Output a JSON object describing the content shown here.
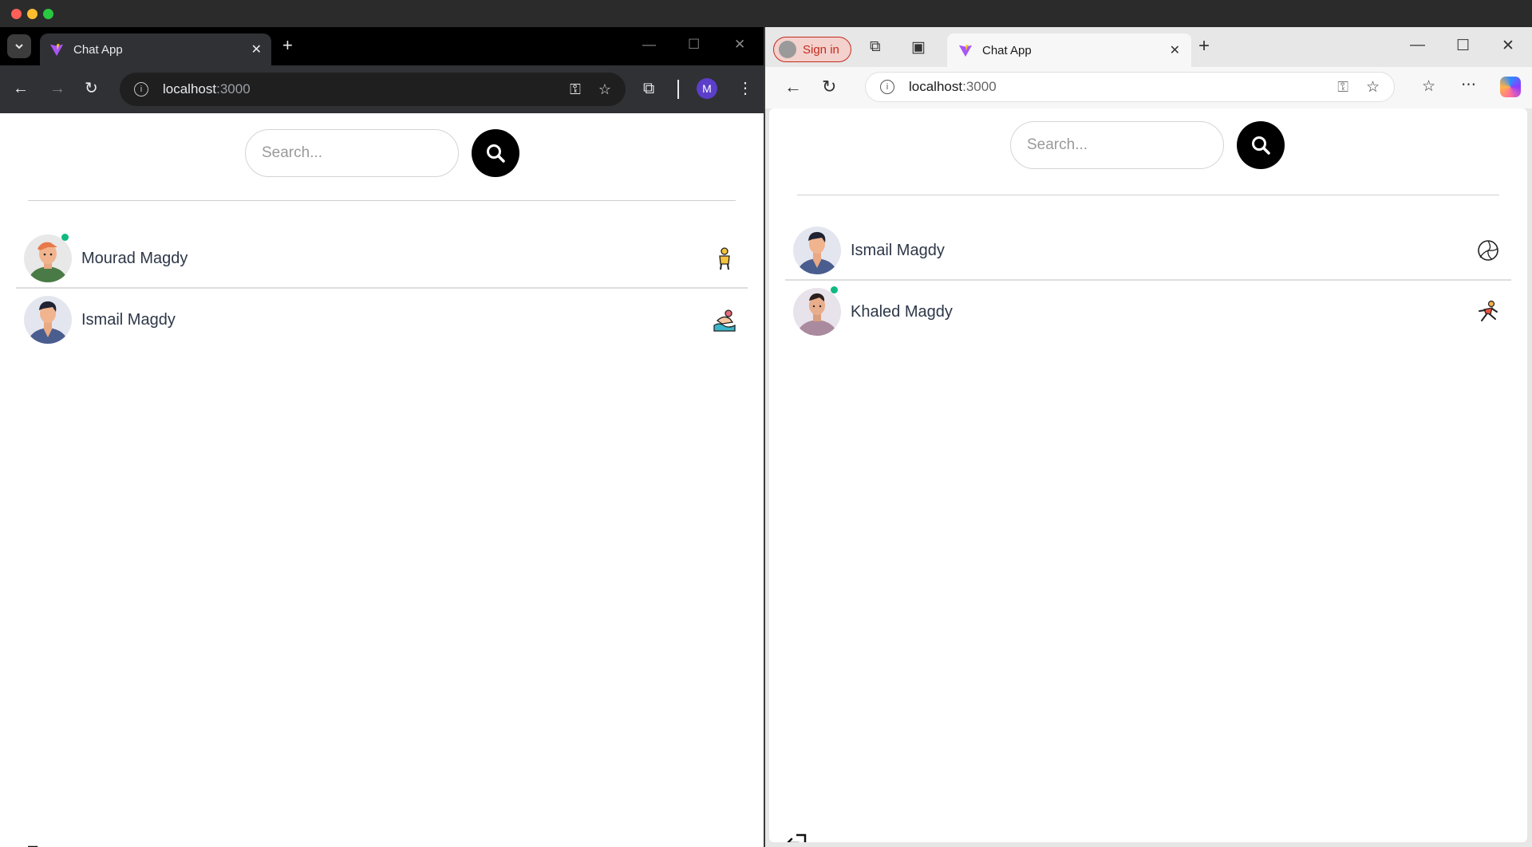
{
  "left_browser": {
    "tab_title": "Chat App",
    "url_host": "localhost",
    "url_port": ":3000",
    "profile_initial": "M",
    "search": {
      "placeholder": "Search..."
    },
    "users": [
      {
        "name": "Mourad Magdy",
        "online": true,
        "emoji_icon": "person-standing-icon"
      },
      {
        "name": "Ismail Magdy",
        "online": false,
        "emoji_icon": "person-swimming-icon"
      }
    ]
  },
  "right_browser": {
    "signin_label": "Sign in",
    "tab_title": "Chat App",
    "url_host": "localhost",
    "url_port": ":3000",
    "search": {
      "placeholder": "Search..."
    },
    "users": [
      {
        "name": "Ismail Magdy",
        "online": false,
        "emoji_icon": "volleyball-icon"
      },
      {
        "name": "Khaled Magdy",
        "online": true,
        "emoji_icon": "person-running-icon"
      }
    ]
  },
  "colors": {
    "online": "#10b981",
    "edge_signin": "#c42b1c"
  }
}
